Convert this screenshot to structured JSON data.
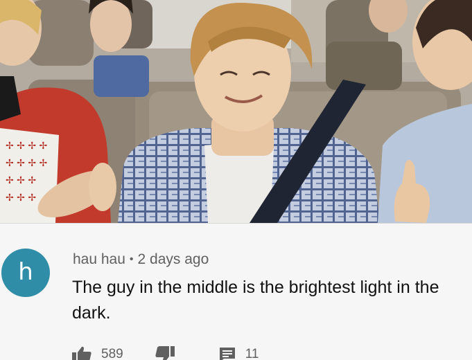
{
  "comment": {
    "avatar_letter": "h",
    "author": "hau hau",
    "separator": "•",
    "timestamp": "2 days ago",
    "text": "The guy in the middle is the brightest light in the dark.",
    "like_count": "589",
    "reply_count": "11"
  },
  "icons": {
    "like": "thumbs-up-icon",
    "dislike": "thumbs-down-icon",
    "replies": "comment-icon"
  },
  "colors": {
    "avatar": "#2f8da8",
    "meta_text": "#606060",
    "comment_text": "#111111",
    "background": "#f6f6f6"
  }
}
